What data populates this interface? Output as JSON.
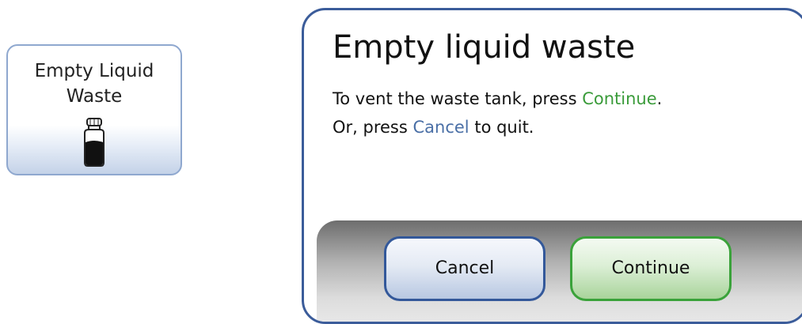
{
  "tile": {
    "label": "Empty Liquid\nWaste",
    "icon": "waste-bottle-icon"
  },
  "dialog": {
    "title": "Empty liquid waste",
    "line1_prefix": "To vent the waste tank, press ",
    "line1_keyword": "Continue",
    "line1_suffix": ".",
    "line2_prefix": "Or, press ",
    "line2_keyword": "Cancel",
    "line2_suffix": " to quit."
  },
  "buttons": {
    "cancel_label": "Cancel",
    "continue_label": "Continue"
  },
  "colors": {
    "dialog_border": "#3b5c9a",
    "continue_accent": "#3a9b3a",
    "cancel_accent": "#4a6fa6"
  }
}
